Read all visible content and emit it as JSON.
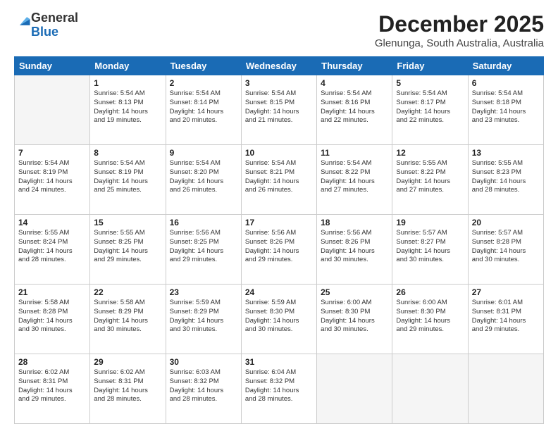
{
  "header": {
    "logo_general": "General",
    "logo_blue": "Blue",
    "title": "December 2025",
    "subtitle": "Glenunga, South Australia, Australia"
  },
  "calendar": {
    "days_of_week": [
      "Sunday",
      "Monday",
      "Tuesday",
      "Wednesday",
      "Thursday",
      "Friday",
      "Saturday"
    ],
    "weeks": [
      [
        {
          "day": "",
          "info": ""
        },
        {
          "day": "1",
          "info": "Sunrise: 5:54 AM\nSunset: 8:13 PM\nDaylight: 14 hours\nand 19 minutes."
        },
        {
          "day": "2",
          "info": "Sunrise: 5:54 AM\nSunset: 8:14 PM\nDaylight: 14 hours\nand 20 minutes."
        },
        {
          "day": "3",
          "info": "Sunrise: 5:54 AM\nSunset: 8:15 PM\nDaylight: 14 hours\nand 21 minutes."
        },
        {
          "day": "4",
          "info": "Sunrise: 5:54 AM\nSunset: 8:16 PM\nDaylight: 14 hours\nand 22 minutes."
        },
        {
          "day": "5",
          "info": "Sunrise: 5:54 AM\nSunset: 8:17 PM\nDaylight: 14 hours\nand 22 minutes."
        },
        {
          "day": "6",
          "info": "Sunrise: 5:54 AM\nSunset: 8:18 PM\nDaylight: 14 hours\nand 23 minutes."
        }
      ],
      [
        {
          "day": "7",
          "info": "Sunrise: 5:54 AM\nSunset: 8:19 PM\nDaylight: 14 hours\nand 24 minutes."
        },
        {
          "day": "8",
          "info": "Sunrise: 5:54 AM\nSunset: 8:19 PM\nDaylight: 14 hours\nand 25 minutes."
        },
        {
          "day": "9",
          "info": "Sunrise: 5:54 AM\nSunset: 8:20 PM\nDaylight: 14 hours\nand 26 minutes."
        },
        {
          "day": "10",
          "info": "Sunrise: 5:54 AM\nSunset: 8:21 PM\nDaylight: 14 hours\nand 26 minutes."
        },
        {
          "day": "11",
          "info": "Sunrise: 5:54 AM\nSunset: 8:22 PM\nDaylight: 14 hours\nand 27 minutes."
        },
        {
          "day": "12",
          "info": "Sunrise: 5:55 AM\nSunset: 8:22 PM\nDaylight: 14 hours\nand 27 minutes."
        },
        {
          "day": "13",
          "info": "Sunrise: 5:55 AM\nSunset: 8:23 PM\nDaylight: 14 hours\nand 28 minutes."
        }
      ],
      [
        {
          "day": "14",
          "info": "Sunrise: 5:55 AM\nSunset: 8:24 PM\nDaylight: 14 hours\nand 28 minutes."
        },
        {
          "day": "15",
          "info": "Sunrise: 5:55 AM\nSunset: 8:25 PM\nDaylight: 14 hours\nand 29 minutes."
        },
        {
          "day": "16",
          "info": "Sunrise: 5:56 AM\nSunset: 8:25 PM\nDaylight: 14 hours\nand 29 minutes."
        },
        {
          "day": "17",
          "info": "Sunrise: 5:56 AM\nSunset: 8:26 PM\nDaylight: 14 hours\nand 29 minutes."
        },
        {
          "day": "18",
          "info": "Sunrise: 5:56 AM\nSunset: 8:26 PM\nDaylight: 14 hours\nand 30 minutes."
        },
        {
          "day": "19",
          "info": "Sunrise: 5:57 AM\nSunset: 8:27 PM\nDaylight: 14 hours\nand 30 minutes."
        },
        {
          "day": "20",
          "info": "Sunrise: 5:57 AM\nSunset: 8:28 PM\nDaylight: 14 hours\nand 30 minutes."
        }
      ],
      [
        {
          "day": "21",
          "info": "Sunrise: 5:58 AM\nSunset: 8:28 PM\nDaylight: 14 hours\nand 30 minutes."
        },
        {
          "day": "22",
          "info": "Sunrise: 5:58 AM\nSunset: 8:29 PM\nDaylight: 14 hours\nand 30 minutes."
        },
        {
          "day": "23",
          "info": "Sunrise: 5:59 AM\nSunset: 8:29 PM\nDaylight: 14 hours\nand 30 minutes."
        },
        {
          "day": "24",
          "info": "Sunrise: 5:59 AM\nSunset: 8:30 PM\nDaylight: 14 hours\nand 30 minutes."
        },
        {
          "day": "25",
          "info": "Sunrise: 6:00 AM\nSunset: 8:30 PM\nDaylight: 14 hours\nand 30 minutes."
        },
        {
          "day": "26",
          "info": "Sunrise: 6:00 AM\nSunset: 8:30 PM\nDaylight: 14 hours\nand 29 minutes."
        },
        {
          "day": "27",
          "info": "Sunrise: 6:01 AM\nSunset: 8:31 PM\nDaylight: 14 hours\nand 29 minutes."
        }
      ],
      [
        {
          "day": "28",
          "info": "Sunrise: 6:02 AM\nSunset: 8:31 PM\nDaylight: 14 hours\nand 29 minutes."
        },
        {
          "day": "29",
          "info": "Sunrise: 6:02 AM\nSunset: 8:31 PM\nDaylight: 14 hours\nand 28 minutes."
        },
        {
          "day": "30",
          "info": "Sunrise: 6:03 AM\nSunset: 8:32 PM\nDaylight: 14 hours\nand 28 minutes."
        },
        {
          "day": "31",
          "info": "Sunrise: 6:04 AM\nSunset: 8:32 PM\nDaylight: 14 hours\nand 28 minutes."
        },
        {
          "day": "",
          "info": ""
        },
        {
          "day": "",
          "info": ""
        },
        {
          "day": "",
          "info": ""
        }
      ]
    ]
  }
}
